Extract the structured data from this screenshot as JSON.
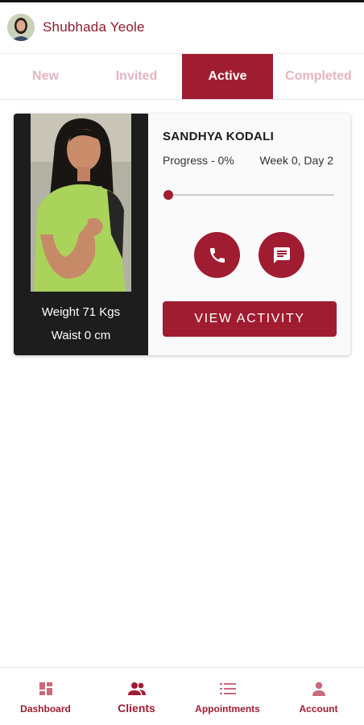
{
  "header": {
    "user_name": "Shubhada Yeole",
    "avatar_icon": "user-avatar"
  },
  "tabs": [
    {
      "label": "New",
      "active": false
    },
    {
      "label": "Invited",
      "active": false
    },
    {
      "label": "Active",
      "active": true
    },
    {
      "label": "Completed",
      "active": false
    }
  ],
  "client_card": {
    "name": "SANDHYA KODALI",
    "progress_text": "Progress - 0%",
    "progress_value": 0,
    "week_text": "Week 0, Day 2",
    "weight_text": "Weight 71 Kgs",
    "waist_text": "Waist 0 cm",
    "call_icon": "phone-icon",
    "message_icon": "message-icon",
    "view_button_label": "VIEW ACTIVITY"
  },
  "bottom_nav": [
    {
      "label": "Dashboard",
      "icon": "dashboard-icon",
      "selected": false
    },
    {
      "label": "Clients",
      "icon": "clients-icon",
      "selected": true
    },
    {
      "label": "Appointments",
      "icon": "list-icon",
      "selected": false
    },
    {
      "label": "Account",
      "icon": "account-icon",
      "selected": false
    }
  ],
  "colors": {
    "accent": "#a01c31",
    "tab_inactive_text": "#e3b5be",
    "card_left_bg": "#1d1d1d"
  }
}
